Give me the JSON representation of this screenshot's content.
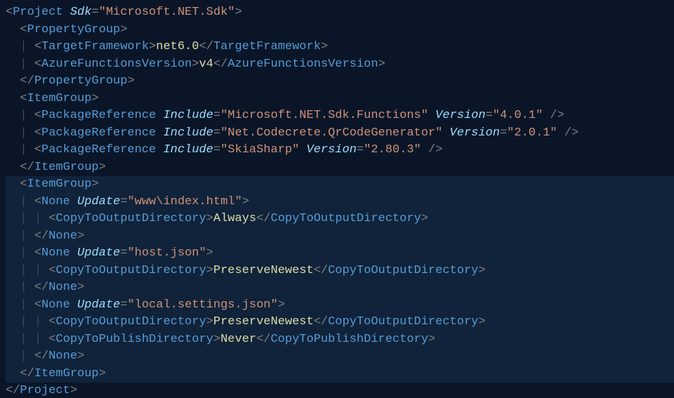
{
  "lines": [
    {
      "hl": false,
      "indent": 0,
      "tokens": [
        {
          "c": "delim",
          "t": "<"
        },
        {
          "c": "tag",
          "t": "Project"
        },
        {
          "c": "",
          "t": " "
        },
        {
          "c": "attr",
          "t": "Sdk"
        },
        {
          "c": "delim",
          "t": "="
        },
        {
          "c": "str",
          "t": "\"Microsoft.NET.Sdk\""
        },
        {
          "c": "delim",
          "t": ">"
        }
      ]
    },
    {
      "hl": false,
      "indent": 1,
      "tokens": [
        {
          "c": "delim",
          "t": "<"
        },
        {
          "c": "tag",
          "t": "PropertyGroup"
        },
        {
          "c": "delim",
          "t": ">"
        }
      ]
    },
    {
      "hl": false,
      "indent": 2,
      "tokens": [
        {
          "c": "delim",
          "t": "<"
        },
        {
          "c": "tag",
          "t": "TargetFramework"
        },
        {
          "c": "delim",
          "t": ">"
        },
        {
          "c": "text",
          "t": "net6.0"
        },
        {
          "c": "delim",
          "t": "</"
        },
        {
          "c": "tag",
          "t": "TargetFramework"
        },
        {
          "c": "delim",
          "t": ">"
        }
      ]
    },
    {
      "hl": false,
      "indent": 2,
      "tokens": [
        {
          "c": "delim",
          "t": "<"
        },
        {
          "c": "tag",
          "t": "AzureFunctionsVersion"
        },
        {
          "c": "delim",
          "t": ">"
        },
        {
          "c": "text",
          "t": "v4"
        },
        {
          "c": "delim",
          "t": "</"
        },
        {
          "c": "tag",
          "t": "AzureFunctionsVersion"
        },
        {
          "c": "delim",
          "t": ">"
        }
      ]
    },
    {
      "hl": false,
      "indent": 1,
      "tokens": [
        {
          "c": "delim",
          "t": "</"
        },
        {
          "c": "tag",
          "t": "PropertyGroup"
        },
        {
          "c": "delim",
          "t": ">"
        }
      ]
    },
    {
      "hl": false,
      "indent": 1,
      "tokens": [
        {
          "c": "delim",
          "t": "<"
        },
        {
          "c": "tag",
          "t": "ItemGroup"
        },
        {
          "c": "delim",
          "t": ">"
        }
      ]
    },
    {
      "hl": false,
      "indent": 2,
      "tokens": [
        {
          "c": "delim",
          "t": "<"
        },
        {
          "c": "tag",
          "t": "PackageReference"
        },
        {
          "c": "",
          "t": " "
        },
        {
          "c": "attr",
          "t": "Include"
        },
        {
          "c": "delim",
          "t": "="
        },
        {
          "c": "str",
          "t": "\"Microsoft.NET.Sdk.Functions\""
        },
        {
          "c": "",
          "t": " "
        },
        {
          "c": "attr",
          "t": "Version"
        },
        {
          "c": "delim",
          "t": "="
        },
        {
          "c": "str",
          "t": "\"4.0.1\""
        },
        {
          "c": "",
          "t": " "
        },
        {
          "c": "delim",
          "t": "/>"
        }
      ]
    },
    {
      "hl": false,
      "indent": 2,
      "tokens": [
        {
          "c": "delim",
          "t": "<"
        },
        {
          "c": "tag",
          "t": "PackageReference"
        },
        {
          "c": "",
          "t": " "
        },
        {
          "c": "attr",
          "t": "Include"
        },
        {
          "c": "delim",
          "t": "="
        },
        {
          "c": "str",
          "t": "\"Net.Codecrete.QrCodeGenerator\""
        },
        {
          "c": "",
          "t": " "
        },
        {
          "c": "attr",
          "t": "Version"
        },
        {
          "c": "delim",
          "t": "="
        },
        {
          "c": "str",
          "t": "\"2.0.1\""
        },
        {
          "c": "",
          "t": " "
        },
        {
          "c": "delim",
          "t": "/>"
        }
      ]
    },
    {
      "hl": false,
      "indent": 2,
      "tokens": [
        {
          "c": "delim",
          "t": "<"
        },
        {
          "c": "tag",
          "t": "PackageReference"
        },
        {
          "c": "",
          "t": " "
        },
        {
          "c": "attr",
          "t": "Include"
        },
        {
          "c": "delim",
          "t": "="
        },
        {
          "c": "str",
          "t": "\"SkiaSharp\""
        },
        {
          "c": "",
          "t": " "
        },
        {
          "c": "attr",
          "t": "Version"
        },
        {
          "c": "delim",
          "t": "="
        },
        {
          "c": "str",
          "t": "\"2.80.3\""
        },
        {
          "c": "",
          "t": " "
        },
        {
          "c": "delim",
          "t": "/>"
        }
      ]
    },
    {
      "hl": false,
      "indent": 1,
      "tokens": [
        {
          "c": "delim",
          "t": "</"
        },
        {
          "c": "tag",
          "t": "ItemGroup"
        },
        {
          "c": "delim",
          "t": ">"
        }
      ]
    },
    {
      "hl": true,
      "indent": 1,
      "tokens": [
        {
          "c": "delim",
          "t": "<"
        },
        {
          "c": "tag",
          "t": "ItemGroup"
        },
        {
          "c": "delim",
          "t": ">"
        }
      ]
    },
    {
      "hl": true,
      "indent": 2,
      "tokens": [
        {
          "c": "delim",
          "t": "<"
        },
        {
          "c": "tag",
          "t": "None"
        },
        {
          "c": "",
          "t": " "
        },
        {
          "c": "attr",
          "t": "Update"
        },
        {
          "c": "delim",
          "t": "="
        },
        {
          "c": "str",
          "t": "\"www\\index.html\""
        },
        {
          "c": "delim",
          "t": ">"
        }
      ]
    },
    {
      "hl": true,
      "indent": 3,
      "tokens": [
        {
          "c": "delim",
          "t": "<"
        },
        {
          "c": "tag",
          "t": "CopyToOutputDirectory"
        },
        {
          "c": "delim",
          "t": ">"
        },
        {
          "c": "text",
          "t": "Always"
        },
        {
          "c": "delim",
          "t": "</"
        },
        {
          "c": "tag",
          "t": "CopyToOutputDirectory"
        },
        {
          "c": "delim",
          "t": ">"
        }
      ]
    },
    {
      "hl": true,
      "indent": 2,
      "tokens": [
        {
          "c": "delim",
          "t": "</"
        },
        {
          "c": "tag",
          "t": "None"
        },
        {
          "c": "delim",
          "t": ">"
        }
      ]
    },
    {
      "hl": true,
      "indent": 2,
      "tokens": [
        {
          "c": "delim",
          "t": "<"
        },
        {
          "c": "tag",
          "t": "None"
        },
        {
          "c": "",
          "t": " "
        },
        {
          "c": "attr",
          "t": "Update"
        },
        {
          "c": "delim",
          "t": "="
        },
        {
          "c": "str",
          "t": "\"host.json\""
        },
        {
          "c": "delim",
          "t": ">"
        }
      ]
    },
    {
      "hl": true,
      "indent": 3,
      "tokens": [
        {
          "c": "delim",
          "t": "<"
        },
        {
          "c": "tag",
          "t": "CopyToOutputDirectory"
        },
        {
          "c": "delim",
          "t": ">"
        },
        {
          "c": "text",
          "t": "PreserveNewest"
        },
        {
          "c": "delim",
          "t": "</"
        },
        {
          "c": "tag",
          "t": "CopyToOutputDirectory"
        },
        {
          "c": "delim",
          "t": ">"
        }
      ]
    },
    {
      "hl": true,
      "indent": 2,
      "tokens": [
        {
          "c": "delim",
          "t": "</"
        },
        {
          "c": "tag",
          "t": "None"
        },
        {
          "c": "delim",
          "t": ">"
        }
      ]
    },
    {
      "hl": true,
      "indent": 2,
      "tokens": [
        {
          "c": "delim",
          "t": "<"
        },
        {
          "c": "tag",
          "t": "None"
        },
        {
          "c": "",
          "t": " "
        },
        {
          "c": "attr",
          "t": "Update"
        },
        {
          "c": "delim",
          "t": "="
        },
        {
          "c": "str",
          "t": "\"local.settings.json\""
        },
        {
          "c": "delim",
          "t": ">"
        }
      ]
    },
    {
      "hl": true,
      "indent": 3,
      "tokens": [
        {
          "c": "delim",
          "t": "<"
        },
        {
          "c": "tag",
          "t": "CopyToOutputDirectory"
        },
        {
          "c": "delim",
          "t": ">"
        },
        {
          "c": "text",
          "t": "PreserveNewest"
        },
        {
          "c": "delim",
          "t": "</"
        },
        {
          "c": "tag",
          "t": "CopyToOutputDirectory"
        },
        {
          "c": "delim",
          "t": ">"
        }
      ]
    },
    {
      "hl": true,
      "indent": 3,
      "tokens": [
        {
          "c": "delim",
          "t": "<"
        },
        {
          "c": "tag",
          "t": "CopyToPublishDirectory"
        },
        {
          "c": "delim",
          "t": ">"
        },
        {
          "c": "text",
          "t": "Never"
        },
        {
          "c": "delim",
          "t": "</"
        },
        {
          "c": "tag",
          "t": "CopyToPublishDirectory"
        },
        {
          "c": "delim",
          "t": ">"
        }
      ]
    },
    {
      "hl": true,
      "indent": 2,
      "tokens": [
        {
          "c": "delim",
          "t": "</"
        },
        {
          "c": "tag",
          "t": "None"
        },
        {
          "c": "delim",
          "t": ">"
        }
      ]
    },
    {
      "hl": true,
      "indent": 1,
      "tokens": [
        {
          "c": "delim",
          "t": "</"
        },
        {
          "c": "tag",
          "t": "ItemGroup"
        },
        {
          "c": "delim",
          "t": ">"
        }
      ]
    },
    {
      "hl": false,
      "indent": 0,
      "tokens": [
        {
          "c": "delim",
          "t": "</"
        },
        {
          "c": "tag",
          "t": "Project"
        },
        {
          "c": "delim",
          "t": ">"
        }
      ]
    }
  ]
}
